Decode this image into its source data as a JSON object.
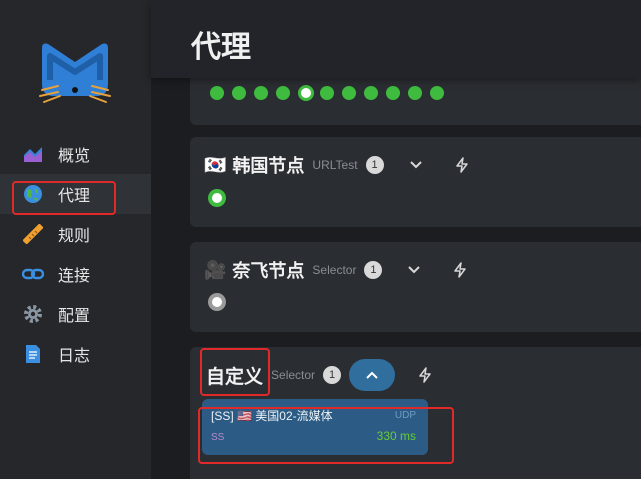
{
  "sidebar": {
    "items": [
      {
        "label": "概览",
        "icon": "overview-chart-icon"
      },
      {
        "label": "代理",
        "icon": "globe-icon"
      },
      {
        "label": "规则",
        "icon": "ruler-icon"
      },
      {
        "label": "连接",
        "icon": "link-icon"
      },
      {
        "label": "配置",
        "icon": "gear-icon"
      },
      {
        "label": "日志",
        "icon": "document-icon"
      }
    ],
    "active": "代理"
  },
  "header": {
    "title": "代理"
  },
  "groups": [
    {
      "flag": "🇰🇷",
      "name": "韩国节点",
      "type": "URLTest",
      "count": "1"
    },
    {
      "flag": "🎥",
      "name": "奈飞节点",
      "type": "Selector",
      "count": "1"
    },
    {
      "name": "自定义",
      "type": "Selector",
      "count": "1",
      "proxy": {
        "name": "[SS] 🇺🇸 美国02-流媒体",
        "udp": "UDP",
        "type": "SS",
        "delay": "330 ms"
      }
    }
  ],
  "colors": {
    "accent": "#2f6e9d",
    "ok": "#3fbb3f",
    "highlight": "#e02a2a",
    "proxy_bg": "#2c5c85"
  }
}
